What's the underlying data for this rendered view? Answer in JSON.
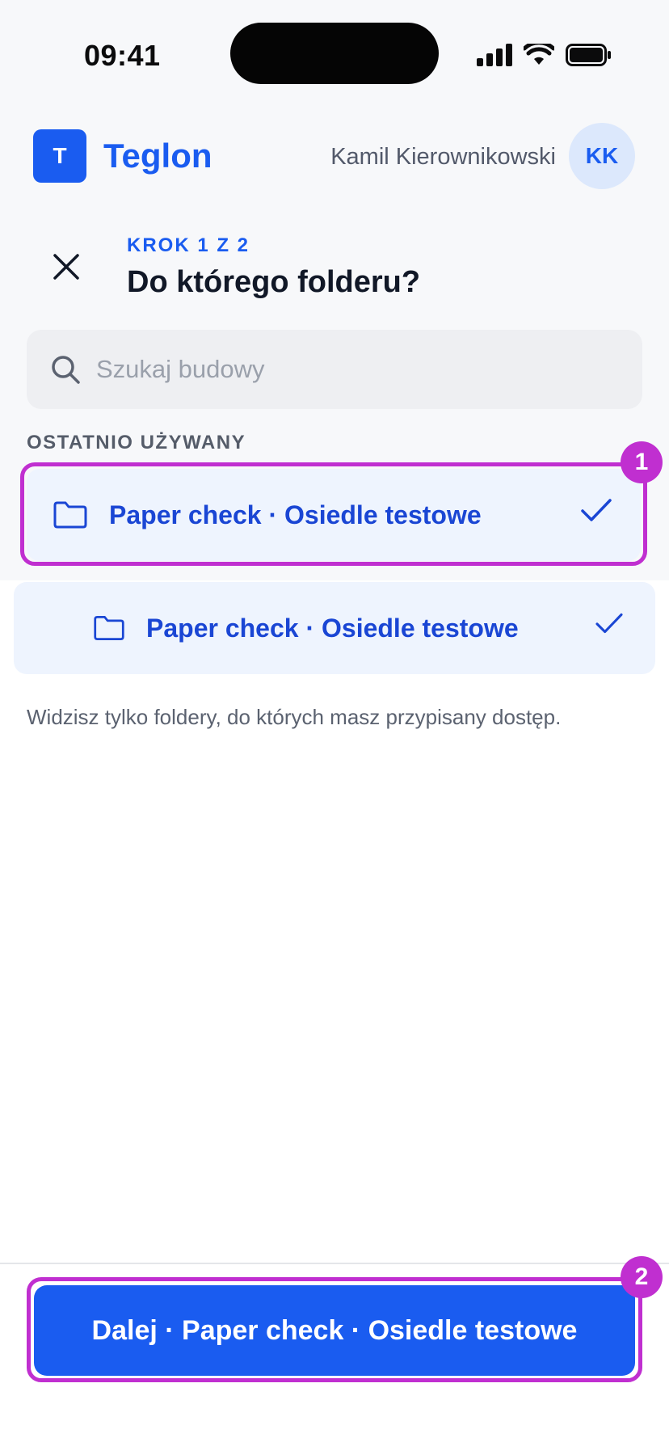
{
  "status_bar": {
    "time": "09:41"
  },
  "header": {
    "brand_initial": "T",
    "brand_name": "Teglon",
    "user_name": "Kamil Kierownikowski",
    "avatar_initials": "KK"
  },
  "step": {
    "label": "KROK 1 Z 2",
    "title": "Do którego folderu?"
  },
  "search": {
    "placeholder": "Szukaj budowy",
    "value": ""
  },
  "recent": {
    "section_label": "OSTATNIO UŻYWANY",
    "items": [
      {
        "label": "Paper check · Osiedle testowe",
        "selected": true
      },
      {
        "label": "Paper check · Osiedle testowe",
        "selected": true
      }
    ]
  },
  "hint": "Widzisz tylko foldery, do których masz przypisany dostęp.",
  "primary_action": {
    "label": "Dalej · Paper check · Osiedle testowe"
  },
  "annotations": {
    "badge_1": "1",
    "badge_2": "2"
  },
  "colors": {
    "brand": "#1a5cf0",
    "row_text": "#1a46d4",
    "row_background": "#eef4fe",
    "annotation": "#c02fd0"
  },
  "icons": [
    "signal-icon",
    "wifi-icon",
    "battery-icon",
    "close-icon",
    "search-icon",
    "folder-icon",
    "check-icon"
  ]
}
